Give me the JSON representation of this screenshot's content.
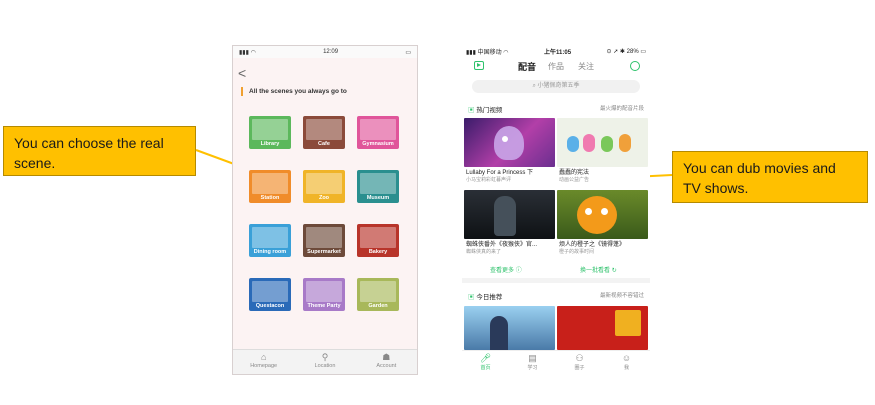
{
  "callouts": {
    "left": "You can choose the real scene.",
    "right": "You can dub movies and TV shows."
  },
  "phone1": {
    "status_time": "12:09",
    "back_glyph": "<",
    "heading": "All the scenes you always go to",
    "scenes": [
      {
        "label": "Library",
        "bg": "#5cb85c"
      },
      {
        "label": "Cafe",
        "bg": "#8b4a3a"
      },
      {
        "label": "Gymnasium",
        "bg": "#e0559a"
      },
      {
        "label": "Station",
        "bg": "#f08c2a"
      },
      {
        "label": "Zoo",
        "bg": "#f0b428"
      },
      {
        "label": "Museum",
        "bg": "#2a8f8f"
      },
      {
        "label": "Dining room",
        "bg": "#3aa0d8"
      },
      {
        "label": "Supermarket",
        "bg": "#6d4a3a"
      },
      {
        "label": "Bakery",
        "bg": "#b8342a"
      },
      {
        "label": "Questacon",
        "bg": "#2a6ab8"
      },
      {
        "label": "Theme Party",
        "bg": "#a87ac8"
      },
      {
        "label": "Garden",
        "bg": "#a8b85a"
      }
    ],
    "tabs": [
      "Homepage",
      "Location",
      "Account"
    ]
  },
  "phone2": {
    "status_left": "中国移动",
    "status_time": "上午11:05",
    "status_battery": "28%",
    "nav": {
      "active": "配音",
      "tab2": "作品",
      "tab3": "关注"
    },
    "search_placeholder": "小猪佩奇第五季",
    "hot_title": "热门视频",
    "hot_right": "最火爆的配音片段",
    "videos": [
      {
        "title": "Lullaby For a Princess 下",
        "sub": "小马宝莉彩虹暮声评"
      },
      {
        "title": "蠢蠢的宪法",
        "sub": "动画公益广告"
      },
      {
        "title": "蜘蛛侠番外《夜猴侠》官...",
        "sub": "蜘蛛侠真的来了"
      },
      {
        "title": "烦人的橙子之《镜得蓬》",
        "sub": "橙子的故事时间"
      }
    ],
    "more_left": "查看更多",
    "more_right": "换一批看看",
    "today_title": "今日推荐",
    "today_right": "最新视频不容错过",
    "tabs": [
      "首页",
      "学习",
      "圈子",
      "我"
    ],
    "accent": "#2ec26b"
  }
}
